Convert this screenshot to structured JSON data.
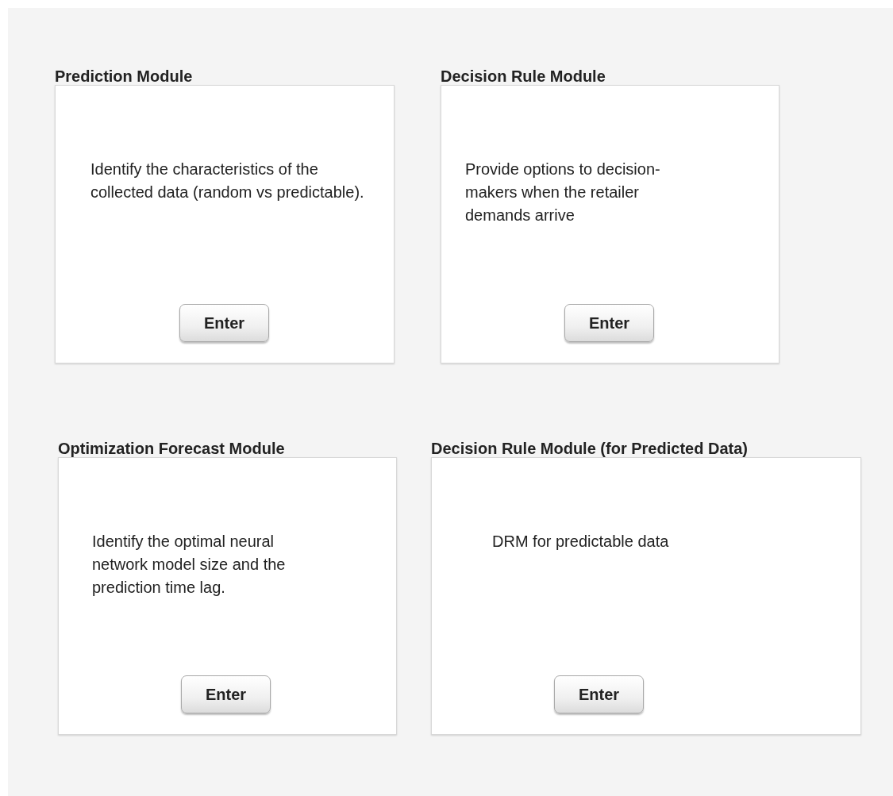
{
  "modules": [
    {
      "title": "Prediction Module",
      "description": "Identify the characteristics of the collected data (random vs predictable).",
      "button": "Enter"
    },
    {
      "title": "Decision Rule Module",
      "description": "Provide options to decision-makers when the retailer demands arrive",
      "button": "Enter"
    },
    {
      "title": "Optimization Forecast Module",
      "description": "Identify the optimal neural network model size and the prediction time lag.",
      "button": "Enter"
    },
    {
      "title": "Decision Rule Module (for Predicted Data)",
      "description": "DRM for predictable data",
      "button": "Enter"
    }
  ]
}
